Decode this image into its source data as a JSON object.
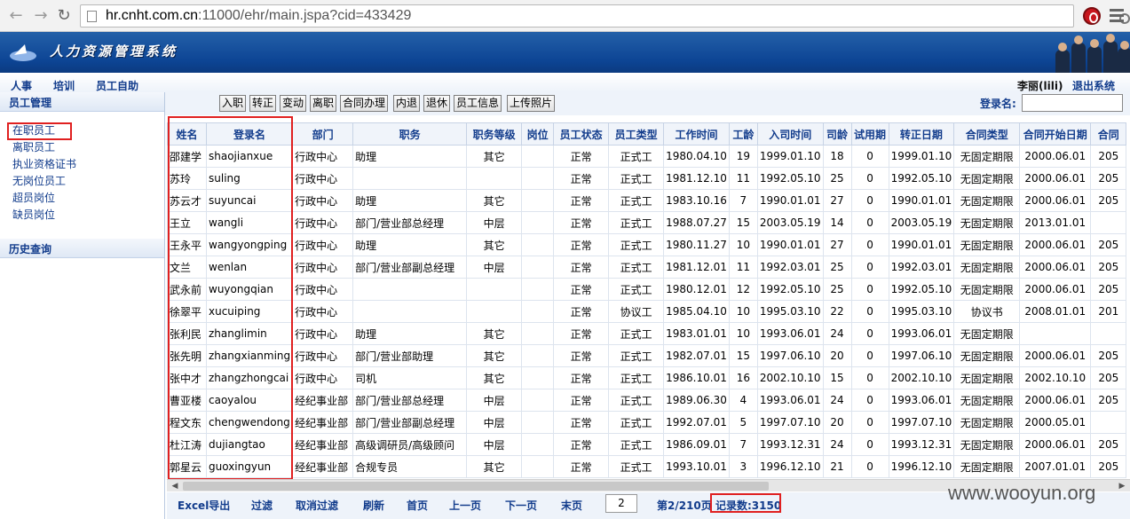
{
  "browser": {
    "url_host": "hr.cnht.com.cn",
    "url_rest": ":11000/ehr/main.jspa?cid=433429"
  },
  "app": {
    "title": "人力资源管理系统",
    "menu": [
      "人事",
      "培训",
      "员工自助"
    ],
    "user_info": "李丽(lili)",
    "logout": "退出系统"
  },
  "sidebar": {
    "section1": "员工管理",
    "items": [
      "在职员工",
      "离职员工",
      "执业资格证书",
      "无岗位员工",
      "超员岗位",
      "缺员岗位"
    ],
    "section2": "历史查询"
  },
  "toolbar": {
    "buttons": [
      "入职",
      "转正",
      "变动",
      "离职",
      "合同办理",
      "内退",
      "退休",
      "员工信息",
      "上传照片"
    ],
    "login_label": "登录名:"
  },
  "table": {
    "headers": [
      "姓名",
      "登录名",
      "部门",
      "职务",
      "职务等级",
      "岗位",
      "员工状态",
      "员工类型",
      "工作时间",
      "工龄",
      "入司时间",
      "司龄",
      "试用期",
      "转正日期",
      "合同类型",
      "合同开始日期",
      "合同"
    ],
    "rows": [
      [
        "邵建学",
        "shaojianxue",
        "行政中心",
        "助理",
        "其它",
        "",
        "正常",
        "正式工",
        "1980.04.10",
        "19",
        "1999.01.10",
        "18",
        "0",
        "1999.01.10",
        "无固定期限",
        "2000.06.01",
        "205"
      ],
      [
        "苏玲",
        "suling",
        "行政中心",
        "",
        "",
        "",
        "正常",
        "正式工",
        "1981.12.10",
        "11",
        "1992.05.10",
        "25",
        "0",
        "1992.05.10",
        "无固定期限",
        "2000.06.01",
        "205"
      ],
      [
        "苏云才",
        "suyuncai",
        "行政中心",
        "助理",
        "其它",
        "",
        "正常",
        "正式工",
        "1983.10.16",
        "7",
        "1990.01.01",
        "27",
        "0",
        "1990.01.01",
        "无固定期限",
        "2000.06.01",
        "205"
      ],
      [
        "王立",
        "wangli",
        "行政中心",
        "部门/营业部总经理",
        "中层",
        "",
        "正常",
        "正式工",
        "1988.07.27",
        "15",
        "2003.05.19",
        "14",
        "0",
        "2003.05.19",
        "无固定期限",
        "2013.01.01",
        ""
      ],
      [
        "王永平",
        "wangyongping",
        "行政中心",
        "助理",
        "其它",
        "",
        "正常",
        "正式工",
        "1980.11.27",
        "10",
        "1990.01.01",
        "27",
        "0",
        "1990.01.01",
        "无固定期限",
        "2000.06.01",
        "205"
      ],
      [
        "文兰",
        "wenlan",
        "行政中心",
        "部门/营业部副总经理",
        "中层",
        "",
        "正常",
        "正式工",
        "1981.12.01",
        "11",
        "1992.03.01",
        "25",
        "0",
        "1992.03.01",
        "无固定期限",
        "2000.06.01",
        "205"
      ],
      [
        "武永前",
        "wuyongqian",
        "行政中心",
        "",
        "",
        "",
        "正常",
        "正式工",
        "1980.12.01",
        "12",
        "1992.05.10",
        "25",
        "0",
        "1992.05.10",
        "无固定期限",
        "2000.06.01",
        "205"
      ],
      [
        "徐翠平",
        "xucuiping",
        "行政中心",
        "",
        "",
        "",
        "正常",
        "协议工",
        "1985.04.10",
        "10",
        "1995.03.10",
        "22",
        "0",
        "1995.03.10",
        "协议书",
        "2008.01.01",
        "201"
      ],
      [
        "张利民",
        "zhanglimin",
        "行政中心",
        "助理",
        "其它",
        "",
        "正常",
        "正式工",
        "1983.01.01",
        "10",
        "1993.06.01",
        "24",
        "0",
        "1993.06.01",
        "无固定期限",
        "",
        ""
      ],
      [
        "张先明",
        "zhangxianming",
        "行政中心",
        "部门/营业部助理",
        "其它",
        "",
        "正常",
        "正式工",
        "1982.07.01",
        "15",
        "1997.06.10",
        "20",
        "0",
        "1997.06.10",
        "无固定期限",
        "2000.06.01",
        "205"
      ],
      [
        "张中才",
        "zhangzhongcai",
        "行政中心",
        "司机",
        "其它",
        "",
        "正常",
        "正式工",
        "1986.10.01",
        "16",
        "2002.10.10",
        "15",
        "0",
        "2002.10.10",
        "无固定期限",
        "2002.10.10",
        "205"
      ],
      [
        "曹亚楼",
        "caoyalou",
        "经纪事业部",
        "部门/营业部总经理",
        "中层",
        "",
        "正常",
        "正式工",
        "1989.06.30",
        "4",
        "1993.06.01",
        "24",
        "0",
        "1993.06.01",
        "无固定期限",
        "2000.06.01",
        "205"
      ],
      [
        "程文东",
        "chengwendong",
        "经纪事业部",
        "部门/营业部副总经理",
        "中层",
        "",
        "正常",
        "正式工",
        "1992.07.01",
        "5",
        "1997.07.10",
        "20",
        "0",
        "1997.07.10",
        "无固定期限",
        "2000.05.01",
        ""
      ],
      [
        "杜江涛",
        "dujiangtao",
        "经纪事业部",
        "高级调研员/高级顾问",
        "中层",
        "",
        "正常",
        "正式工",
        "1986.09.01",
        "7",
        "1993.12.31",
        "24",
        "0",
        "1993.12.31",
        "无固定期限",
        "2000.06.01",
        "205"
      ],
      [
        "郭星云",
        "guoxingyun",
        "经纪事业部",
        "合规专员",
        "其它",
        "",
        "正常",
        "正式工",
        "1993.10.01",
        "3",
        "1996.12.10",
        "21",
        "0",
        "1996.12.10",
        "无固定期限",
        "2007.01.01",
        "205"
      ]
    ]
  },
  "pager": {
    "export": "Excel导出",
    "filter": "过滤",
    "unfilter": "取消过滤",
    "refresh": "刷新",
    "first": "首页",
    "prev": "上一页",
    "next": "下一页",
    "last": "末页",
    "page_input": "2",
    "page_info": "第2/210页",
    "record_count": "记录数:3150"
  },
  "watermark": "www.wooyun.org"
}
